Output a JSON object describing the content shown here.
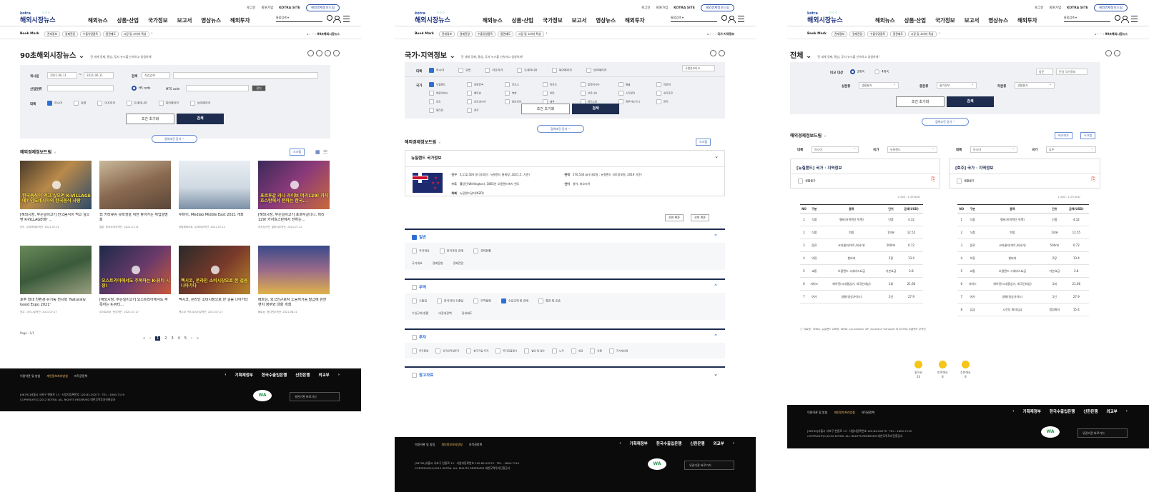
{
  "header": {
    "logo_top": "kotra",
    "logo_main": "해외시장뉴스",
    "util": [
      "로그인",
      "회원가입",
      "KOTRA SITE"
    ],
    "util_pill": "해외경제정보드림",
    "gnb": [
      "해외뉴스",
      "상품·산업",
      "국가정보",
      "보고서",
      "영상뉴스",
      "해외투자"
    ],
    "search_label": "통합검색"
  },
  "bookmark": {
    "label": "Book Mark",
    "chips": [
      "관세정보",
      "경제전망",
      "수출유망품목",
      "통관제도",
      "시장 및 소비자 특성"
    ]
  },
  "p1": {
    "crumb": "90초해외시장뉴스",
    "title": "90초해외시장뉴스",
    "subtitle": "전 세계 경제, 통상, 투자 뉴스를 신속하고 생생하게!",
    "f_period": "게시일",
    "date_from": "2021.06.11",
    "date_to": "2021.06.11",
    "f_search": "검색",
    "search_opt": "직업검색",
    "f_industry": "산업분류",
    "hs": "HS code",
    "mts": "MTS code",
    "find": "찾기",
    "f_region": "대륙",
    "regions": [
      "아시아",
      "유럽",
      "아프리카",
      "오세아니아",
      "북아메리카",
      "남아메리카"
    ],
    "reset": "조건 초기화",
    "search": "검색",
    "toggle": "검색조건 닫기 ⌃",
    "section": "해외경제정보드림",
    "scrap": "스크랩",
    "cards": [
      {
        "cap": "한국음식이 먹고 싶으면 K-VILLAGE에? 인도네시아의 한국음식 사랑",
        "title": "[해외시장, 무슨일이고?] 한국음식이 먹고 싶으면 K-VILLAGE에? ...",
        "meta": [
          "인도",
          "수라바야무역관",
          "2021.07.21"
        ]
      },
      {
        "cap": "",
        "title": "日 키타큐슈 유학생을 위한 찾아가는 취업설명회",
        "meta": [
          "일본",
          "후쿠오카무역관",
          "2021.07.21"
        ]
      },
      {
        "cap": "",
        "title": "두바이, Medlab Middle East 2021 개최",
        "meta": [
          "아랍에미리트",
          "두바이무역관",
          "2021.07.12"
        ]
      },
      {
        "cap": "포르투갈 라나 라이브 머리129! 카자흐스탄에서 전하는 한국...",
        "title": "[해외시장, 무슨일이고?] 포르투갈나니, 머리129! 카자흐스탄에서 전하는...",
        "meta": [
          "카자흐스탄",
          "알마티무역관",
          "2021.07.12"
        ]
      },
      {
        "cap": "",
        "title": "호주 최대 친환경·유기농 전시회 'Naturally Good Expo 2021'",
        "meta": [
          "호주",
          "시드니무역관",
          "2021.07.17"
        ]
      },
      {
        "cap": "오스트리아에서도 주목하는 K-뷰티 시장!",
        "title": "[해외시장, 무슨일이고?] 오스트리아에서도 주목하는 K-뷰티...",
        "meta": [
          "오스트리아",
          "빈무역관",
          "2021.07.17"
        ]
      },
      {
        "cap": "멕시코, 온라인 소비시장으로 한 걸음 나아가다",
        "title": "멕시코, 온라인 소비시장으로 한 걸음 나아가다",
        "meta": [
          "멕시코",
          "멕시코시티무역관",
          "2021.07.17"
        ]
      },
      {
        "cap": "",
        "title": "베트남, 외국인근로자 노동허가증 발급에 관한 현지 정부와 대화 개최",
        "meta": [
          "베트남",
          "호치민무역관",
          "2021.06.21"
        ]
      }
    ],
    "pginfo": "Page : 1/1",
    "pages": [
      "1",
      "2",
      "3",
      "4",
      "5"
    ]
  },
  "p2": {
    "crumb": "국가·지역정보",
    "title": "국가·지역정보",
    "subtitle": "전 세계 경제, 통상, 투자 뉴스를 신속하고 생생하게!",
    "f_region": "대륙",
    "regions": [
      "아시아",
      "유럽",
      "아프리카",
      "오세아니아",
      "북아메리카",
      "남아메리카"
    ],
    "compare": "국별정보비교",
    "f_country": "국가",
    "countries": [
      "뉴질랜드",
      "대한민국",
      "라오스",
      "마카오",
      "말레이시아",
      "몽골",
      "미얀마",
      "방글라데시",
      "베트남",
      "북한",
      "부탄",
      "브루나이",
      "스리랑카",
      "싱가포르",
      "인도",
      "인도네시아",
      "캄보디아",
      "태국",
      "파키스탄",
      "파푸아뉴기니",
      "피지",
      "필리핀",
      "호주"
    ],
    "reset": "조건 초기화",
    "search": "검색",
    "toggle": "검색조건 닫기 ⌃",
    "section": "해외경제정보드림",
    "scrap": "스크랩",
    "country_box": "뉴질랜드 국가정보",
    "info": [
      [
        "인구",
        "5,112,300 명 (자료원 : 뉴질랜드 통계청, 2021.5. 기준)"
      ],
      [
        "수도",
        "웰링턴(Wellington), 1865년 오클랜드에서 천도"
      ],
      [
        "화폐",
        "뉴질랜드달러(NZD)"
      ]
    ],
    "info2": [
      [
        "면적",
        "270,534 ㎢ (자료원 : 뉴질랜드 국토정보원, 2019 기준)"
      ],
      [
        "언어",
        "영어, 마오리어"
      ]
    ],
    "pdf": [
      "전면 PDF",
      "선택 PDF"
    ],
    "acc1": "일반",
    "acc1_items": [
      "국가개요",
      "한국과의 관계",
      "경제현황",
      "국가개요",
      "경제동향",
      "경제전망"
    ],
    "acc2": "무역",
    "acc2_items": [
      "수출입",
      "한국과의 수출입",
      "무역협정",
      "수입규제 및 관세",
      "통관 및 운송",
      "수입규제 현황",
      "비관세장벽",
      "관세제도"
    ],
    "acc3": "투자",
    "acc3_items": [
      "투자환경",
      "외국인직접투자",
      "한국기업 투자",
      "투자진출형식",
      "법인 및 절수",
      "노무",
      "세금",
      "외환",
      "지식재산권"
    ],
    "acc4": "참고자료"
  },
  "p3": {
    "crumb": "90초해외시장뉴스",
    "title": "전체",
    "subtitle": "전 세계 경제, 통상, 투자 뉴스를 신속하고 생생하게!",
    "f_target": "비교 대상",
    "opt1": "2개국",
    "opt2": "4개국",
    "btn_a": "방문",
    "btn_b": "단일 국가정보",
    "f1": "상분류",
    "v1": "생활물가",
    "f2": "중분류",
    "v2": "물가정보",
    "f3": "하분류",
    "v3": "생활물가",
    "reset": "조건 초기화",
    "search": "검색",
    "toggle": "검색조건 닫기 ⌃",
    "section": "해외경제정보드림",
    "print": "비교하기",
    "scrap": "스크랩",
    "left": {
      "region": "아시아",
      "country": "뉴질랜드",
      "heading": "[뉴질랜드] 국가 · 지역정보",
      "sub": "생활물가",
      "unit": "1 USD : 1.39 NZD"
    },
    "right": {
      "region": "아시아",
      "country": "호주",
      "heading": "[호주] 국가 · 지역정보",
      "sub": "생활물가",
      "unit": "1 USD : 1.29 AUD"
    },
    "cols": [
      "NO",
      "구분",
      "품목",
      "단위",
      "금액(USD)"
    ],
    "rows_l": [
      [
        "1",
        "식품",
        "햄버거(빅맥단 빅맥)",
        "단품",
        "4.32"
      ],
      [
        "2",
        "식품",
        "피망",
        "1인분",
        "12.55"
      ],
      [
        "3",
        "음료",
        "코카콜라(마트,회사가)",
        "500ml",
        "0.72"
      ],
      [
        "4",
        "의류",
        "청바지",
        "2장",
        "13.4"
      ],
      [
        "5",
        "교통",
        "오클랜드 시내버스요금",
        "기본요금",
        "2.8"
      ],
      [
        "6",
        "서비스",
        "헤어컷(시내중심가, 외국인대상)",
        "1회",
        "21.66"
      ],
      [
        "7",
        "여가",
        "영화(영상가이드)",
        "1인",
        "27.9"
      ]
    ],
    "rows_r": [
      [
        "1",
        "식품",
        "햄버거(빅맥단 빅맥)",
        "단품",
        "4.32"
      ],
      [
        "2",
        "식품",
        "피망",
        "1인분",
        "12.55"
      ],
      [
        "3",
        "음료",
        "코카콜라(마트,회사가)",
        "500ml",
        "0.72"
      ],
      [
        "4",
        "의류",
        "청바지",
        "2장",
        "13.4"
      ],
      [
        "5",
        "교통",
        "오클랜드 시내버스요금",
        "기본요금",
        "2.8"
      ],
      [
        "6",
        "서비스",
        "헤어컷(시내중심가, 외국인대상)",
        "1회",
        "21.66"
      ],
      [
        "7",
        "여가",
        "영화(영상가이드)",
        "1인",
        "27.9"
      ],
      [
        "8",
        "임금",
        "시간당 최저임금",
        "법정최저",
        "15.4"
      ]
    ],
    "source": "자료원 : WINZ, 뉴질랜드 교육부, WINK, Countdown, BP, Auckland Transport 외 KOTRA 오클랜드 무역관",
    "emos": [
      {
        "label": "좋아요",
        "count": "24"
      },
      {
        "label": "만족해요",
        "count": "8"
      },
      {
        "label": "추천해요",
        "count": "8"
      }
    ]
  },
  "footer": {
    "links": [
      "이용약관 및 방침",
      "개인정보처리방침",
      "저작권정책"
    ],
    "partners": [
      "기획재정부",
      "한국수출입은행",
      "신한은행",
      "외교부"
    ],
    "addr1": "[06792]서울시 서초구 헌릉로 13 · 사업자등록번호 120-82-00275 · TEL : 1600-7119",
    "addr2": "COPYRIGHT(C)2012 KOTRA. ALL RIGHTS RESERVED 대한무역투자진흥공사",
    "wa": "WA",
    "family": "유관기관 바로가기"
  },
  "colors": {
    "navy": "#1d2c4f",
    "blue": "#2e6fd4",
    "filter_bg": "#f0f1f4",
    "footer": "#0b0b0b"
  }
}
